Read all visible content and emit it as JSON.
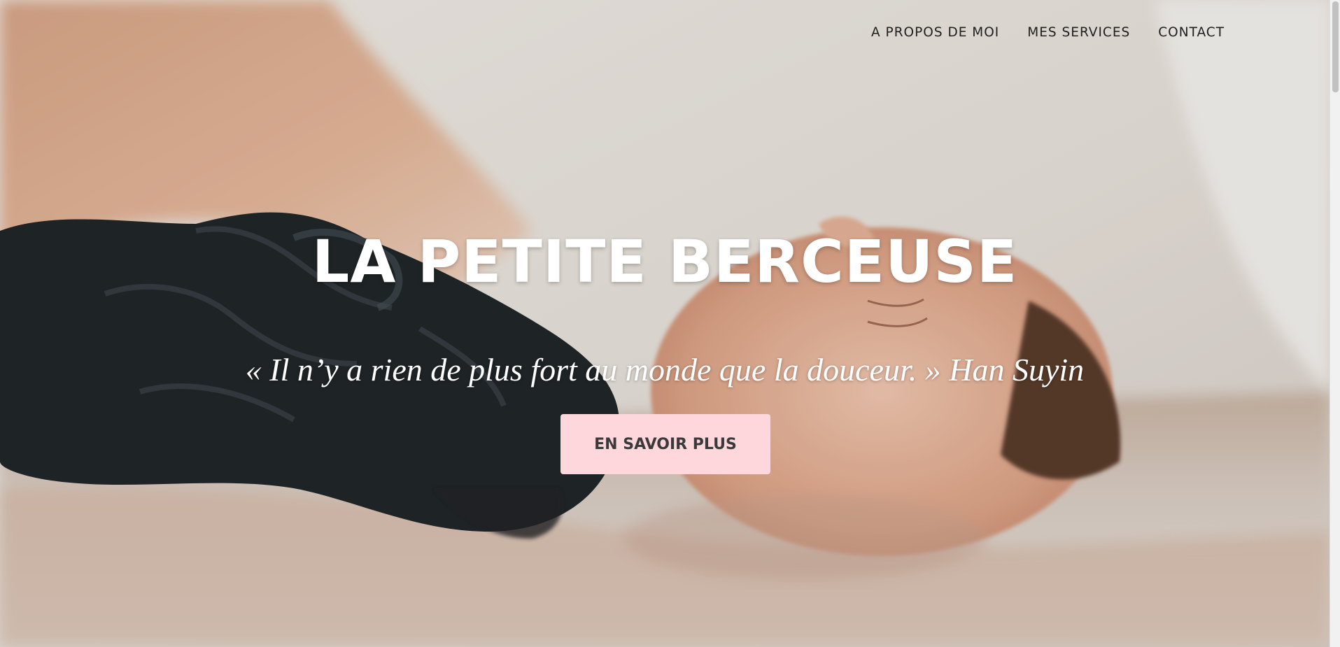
{
  "nav": {
    "about": "A PROPOS DE MOI",
    "services": "MES SERVICES",
    "contact": "CONTACT"
  },
  "hero": {
    "title": "LA PETITE BERCEUSE",
    "quote": "« Il n’y a rien de plus fort au monde que la douceur. » Han Suyin",
    "cta_label": "EN SAVOIR PLUS",
    "cta_color": "#fdd7dc",
    "photo": "newborn-bath-photo"
  }
}
